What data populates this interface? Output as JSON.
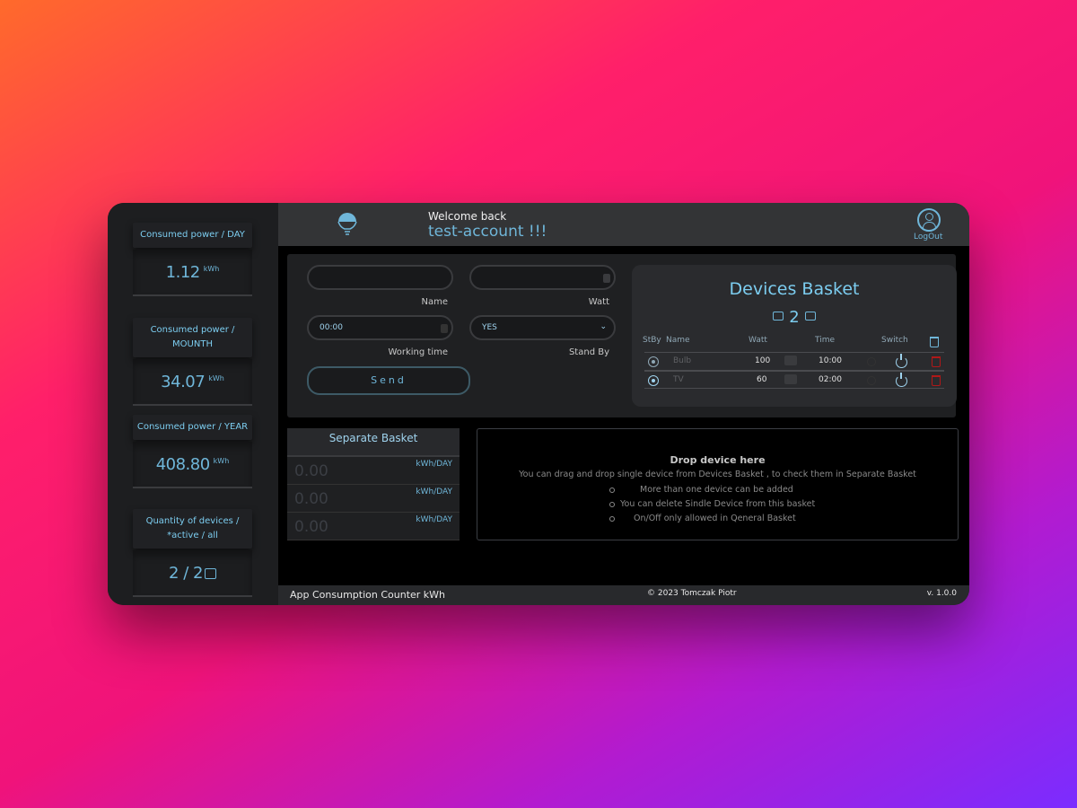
{
  "sidebar": {
    "cards": [
      {
        "label": "Consumed power / DAY",
        "value": "1.12",
        "unit": "kWh"
      },
      {
        "label": "Consumed power / MOUNTH",
        "value": "34.07",
        "unit": "kWh"
      },
      {
        "label": "Consumed power / YEAR",
        "value": "408.80",
        "unit": "kWh"
      },
      {
        "label": "Quantity of devices / *active / all",
        "value": "2 / 2",
        "unit": ""
      }
    ]
  },
  "header": {
    "welcome": "Welcome back",
    "account": "test-account !!!",
    "logout": "LogOut"
  },
  "form": {
    "name_value": "",
    "name_label": "Name",
    "watt_value": "",
    "watt_label": "Watt",
    "time_value": "00:00",
    "time_label": "Working time",
    "standby_value": "YES",
    "standby_label": "Stand By",
    "send_label": "Send"
  },
  "devices_basket": {
    "title": "Devices Basket",
    "count": "2",
    "columns": {
      "stby": "StBy",
      "name": "Name",
      "watt": "Watt",
      "time": "Time",
      "switch": "Switch"
    },
    "rows": [
      {
        "name": "Bulb",
        "watt": "100",
        "time": "10:00"
      },
      {
        "name": "TV",
        "watt": "60",
        "time": "02:00"
      }
    ]
  },
  "separate_basket": {
    "title": "Separate Basket",
    "rows": [
      {
        "value": "0.00",
        "unit": "kWh/DAY"
      },
      {
        "value": "0.00",
        "unit": "kWh/DAY"
      },
      {
        "value": "0.00",
        "unit": "kWh/DAY"
      }
    ]
  },
  "drop_zone": {
    "title": "Drop device here",
    "subtitle": "You can drag and drop single device from Devices Basket , to check them in Separate Basket",
    "items": [
      "More than one device can be added",
      "You can delete Sindle Device from this basket",
      "On/Off only allowed in Qeneral Basket"
    ]
  },
  "footer": {
    "title": "App Consumption Counter kWh",
    "copyright": "© 2023 Tomczak Piotr",
    "version": "v. 1.0.0"
  },
  "colors": {
    "accent": "#6fb6d9",
    "delete": "#b01818"
  },
  "icons": [
    "bulb-icon",
    "user-icon",
    "plug-icon",
    "radio-icon",
    "power-icon",
    "trash-icon"
  ]
}
